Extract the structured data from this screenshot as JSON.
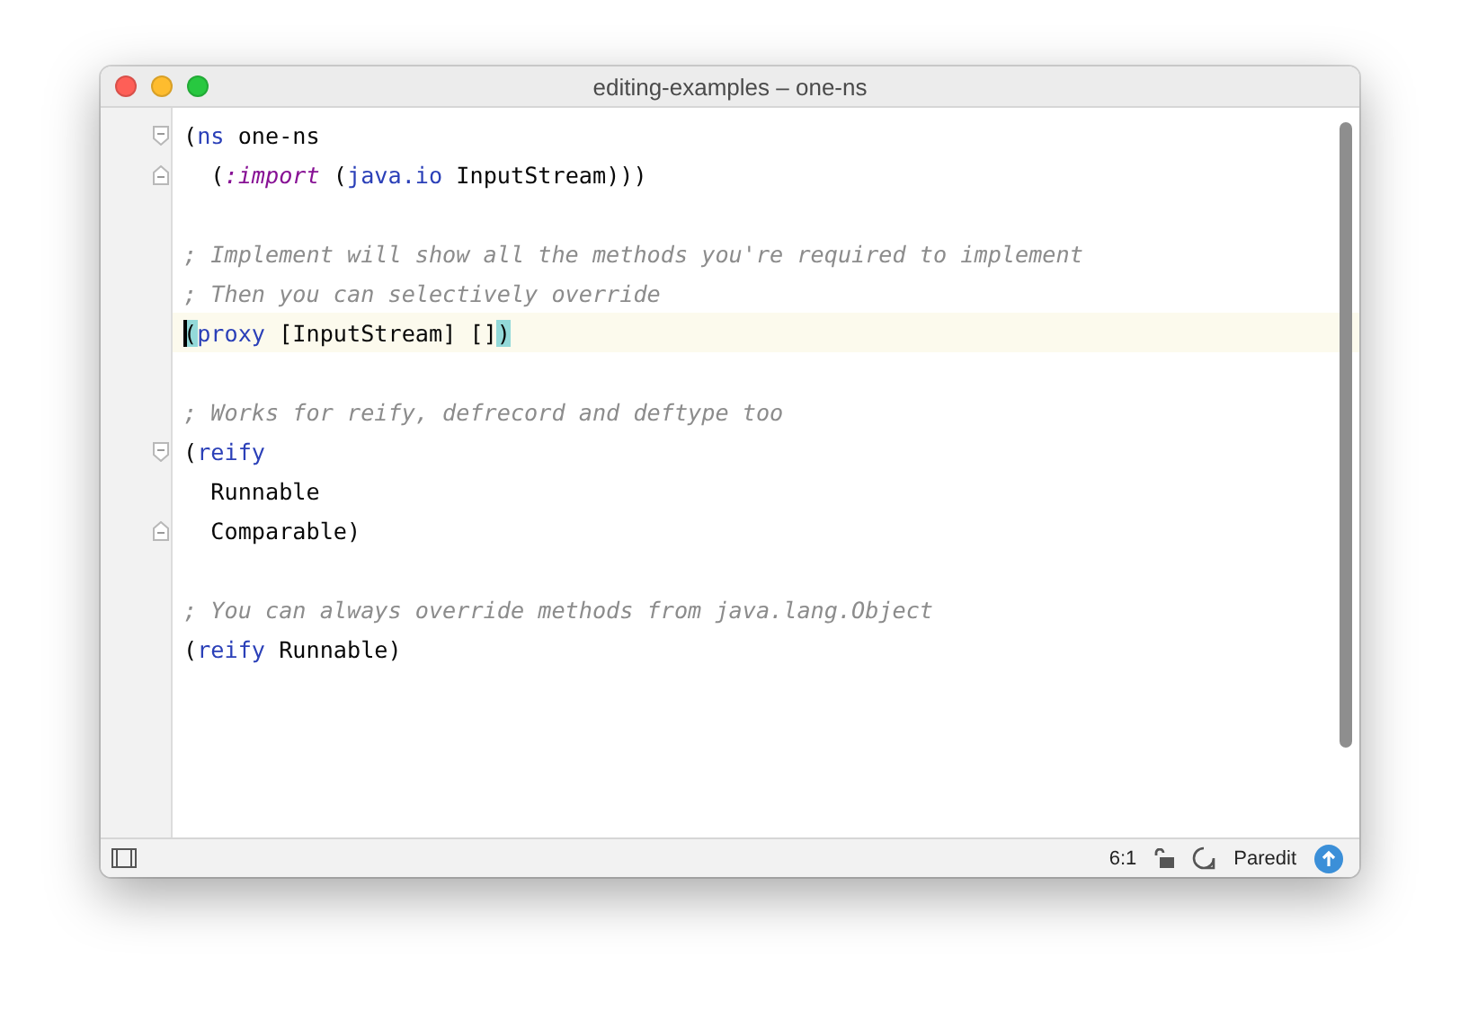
{
  "window": {
    "title": "editing-examples – one-ns"
  },
  "lines": [
    {
      "kind": "code",
      "current": false,
      "fold": {
        "kind": "start"
      },
      "tokens": [
        {
          "kind": "plain",
          "text": "("
        },
        {
          "kind": "keyword",
          "text": "ns"
        },
        {
          "kind": "plain",
          "text": " one-ns"
        }
      ]
    },
    {
      "kind": "code",
      "current": false,
      "fold": {
        "kind": "end"
      },
      "tokens": [
        {
          "kind": "plain",
          "text": "  ("
        },
        {
          "kind": "symbol",
          "text": ":import"
        },
        {
          "kind": "plain",
          "text": " ("
        },
        {
          "kind": "keyword",
          "text": "java.io"
        },
        {
          "kind": "plain",
          "text": " InputStream)))"
        }
      ]
    },
    {
      "kind": "blank",
      "current": false
    },
    {
      "kind": "code",
      "current": false,
      "tokens": [
        {
          "kind": "comment",
          "text": "; Implement will show all the methods you're required to implement"
        }
      ]
    },
    {
      "kind": "code",
      "current": false,
      "tokens": [
        {
          "kind": "comment",
          "text": "; Then you can selectively override"
        }
      ]
    },
    {
      "kind": "code",
      "current": true,
      "tokens": [
        {
          "kind": "match",
          "text": "("
        },
        {
          "kind": "keyword",
          "text": "proxy"
        },
        {
          "kind": "plain",
          "text": " [InputStream] []"
        },
        {
          "kind": "match",
          "text": ")"
        }
      ]
    },
    {
      "kind": "blank",
      "current": false
    },
    {
      "kind": "code",
      "current": false,
      "tokens": [
        {
          "kind": "comment",
          "text": "; Works for reify, defrecord and deftype too"
        }
      ]
    },
    {
      "kind": "code",
      "current": false,
      "fold": {
        "kind": "start"
      },
      "tokens": [
        {
          "kind": "plain",
          "text": "("
        },
        {
          "kind": "keyword",
          "text": "reify"
        }
      ]
    },
    {
      "kind": "code",
      "current": false,
      "tokens": [
        {
          "kind": "plain",
          "text": "  Runnable"
        }
      ]
    },
    {
      "kind": "code",
      "current": false,
      "fold": {
        "kind": "end"
      },
      "tokens": [
        {
          "kind": "plain",
          "text": "  Comparable)"
        }
      ]
    },
    {
      "kind": "blank",
      "current": false
    },
    {
      "kind": "code",
      "current": false,
      "tokens": [
        {
          "kind": "comment",
          "text": "; You can always override methods from java.lang.Object"
        }
      ]
    },
    {
      "kind": "code",
      "current": false,
      "tokens": [
        {
          "kind": "plain",
          "text": "("
        },
        {
          "kind": "keyword",
          "text": "reify"
        },
        {
          "kind": "plain",
          "text": " Runnable)"
        }
      ]
    }
  ],
  "status_bar": {
    "position": "6:1",
    "mode": "Paredit"
  }
}
